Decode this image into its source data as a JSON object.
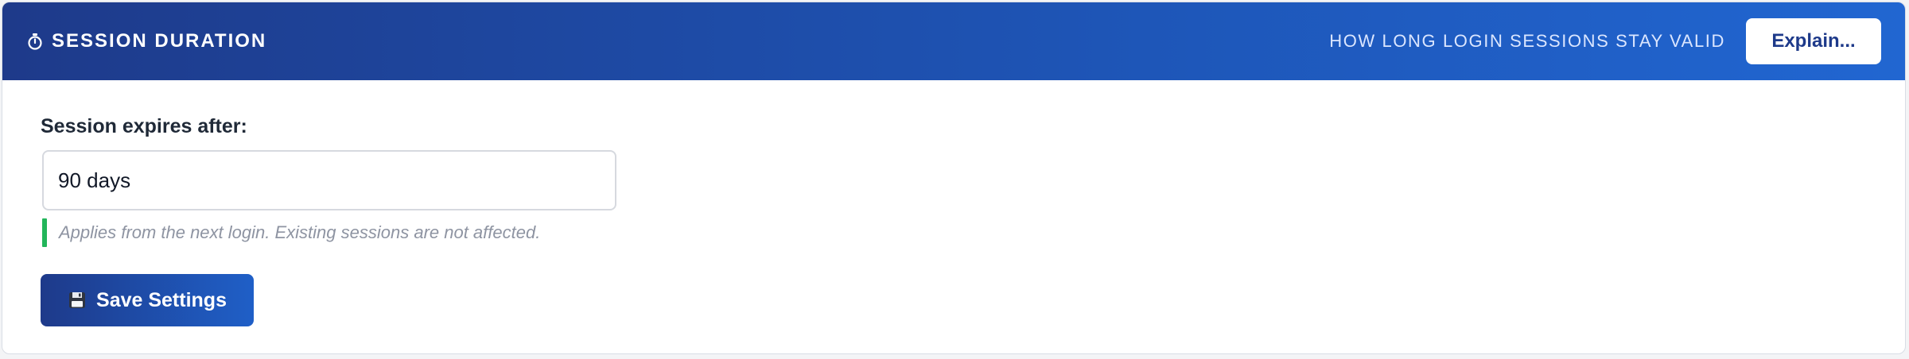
{
  "header": {
    "icon": "timer-icon",
    "title": "SESSION DURATION",
    "subtitle": "HOW LONG LOGIN SESSIONS STAY VALID",
    "explain_label": "Explain..."
  },
  "form": {
    "label": "Session expires after:",
    "value": "90 days",
    "hint": "Applies from the next login. Existing sessions are not affected."
  },
  "actions": {
    "save_icon": "floppy-disk-icon",
    "save_label": "Save Settings"
  },
  "colors": {
    "header_start": "#1e3a8a",
    "header_end": "#2166d1",
    "hint_accent": "#22b55a"
  }
}
